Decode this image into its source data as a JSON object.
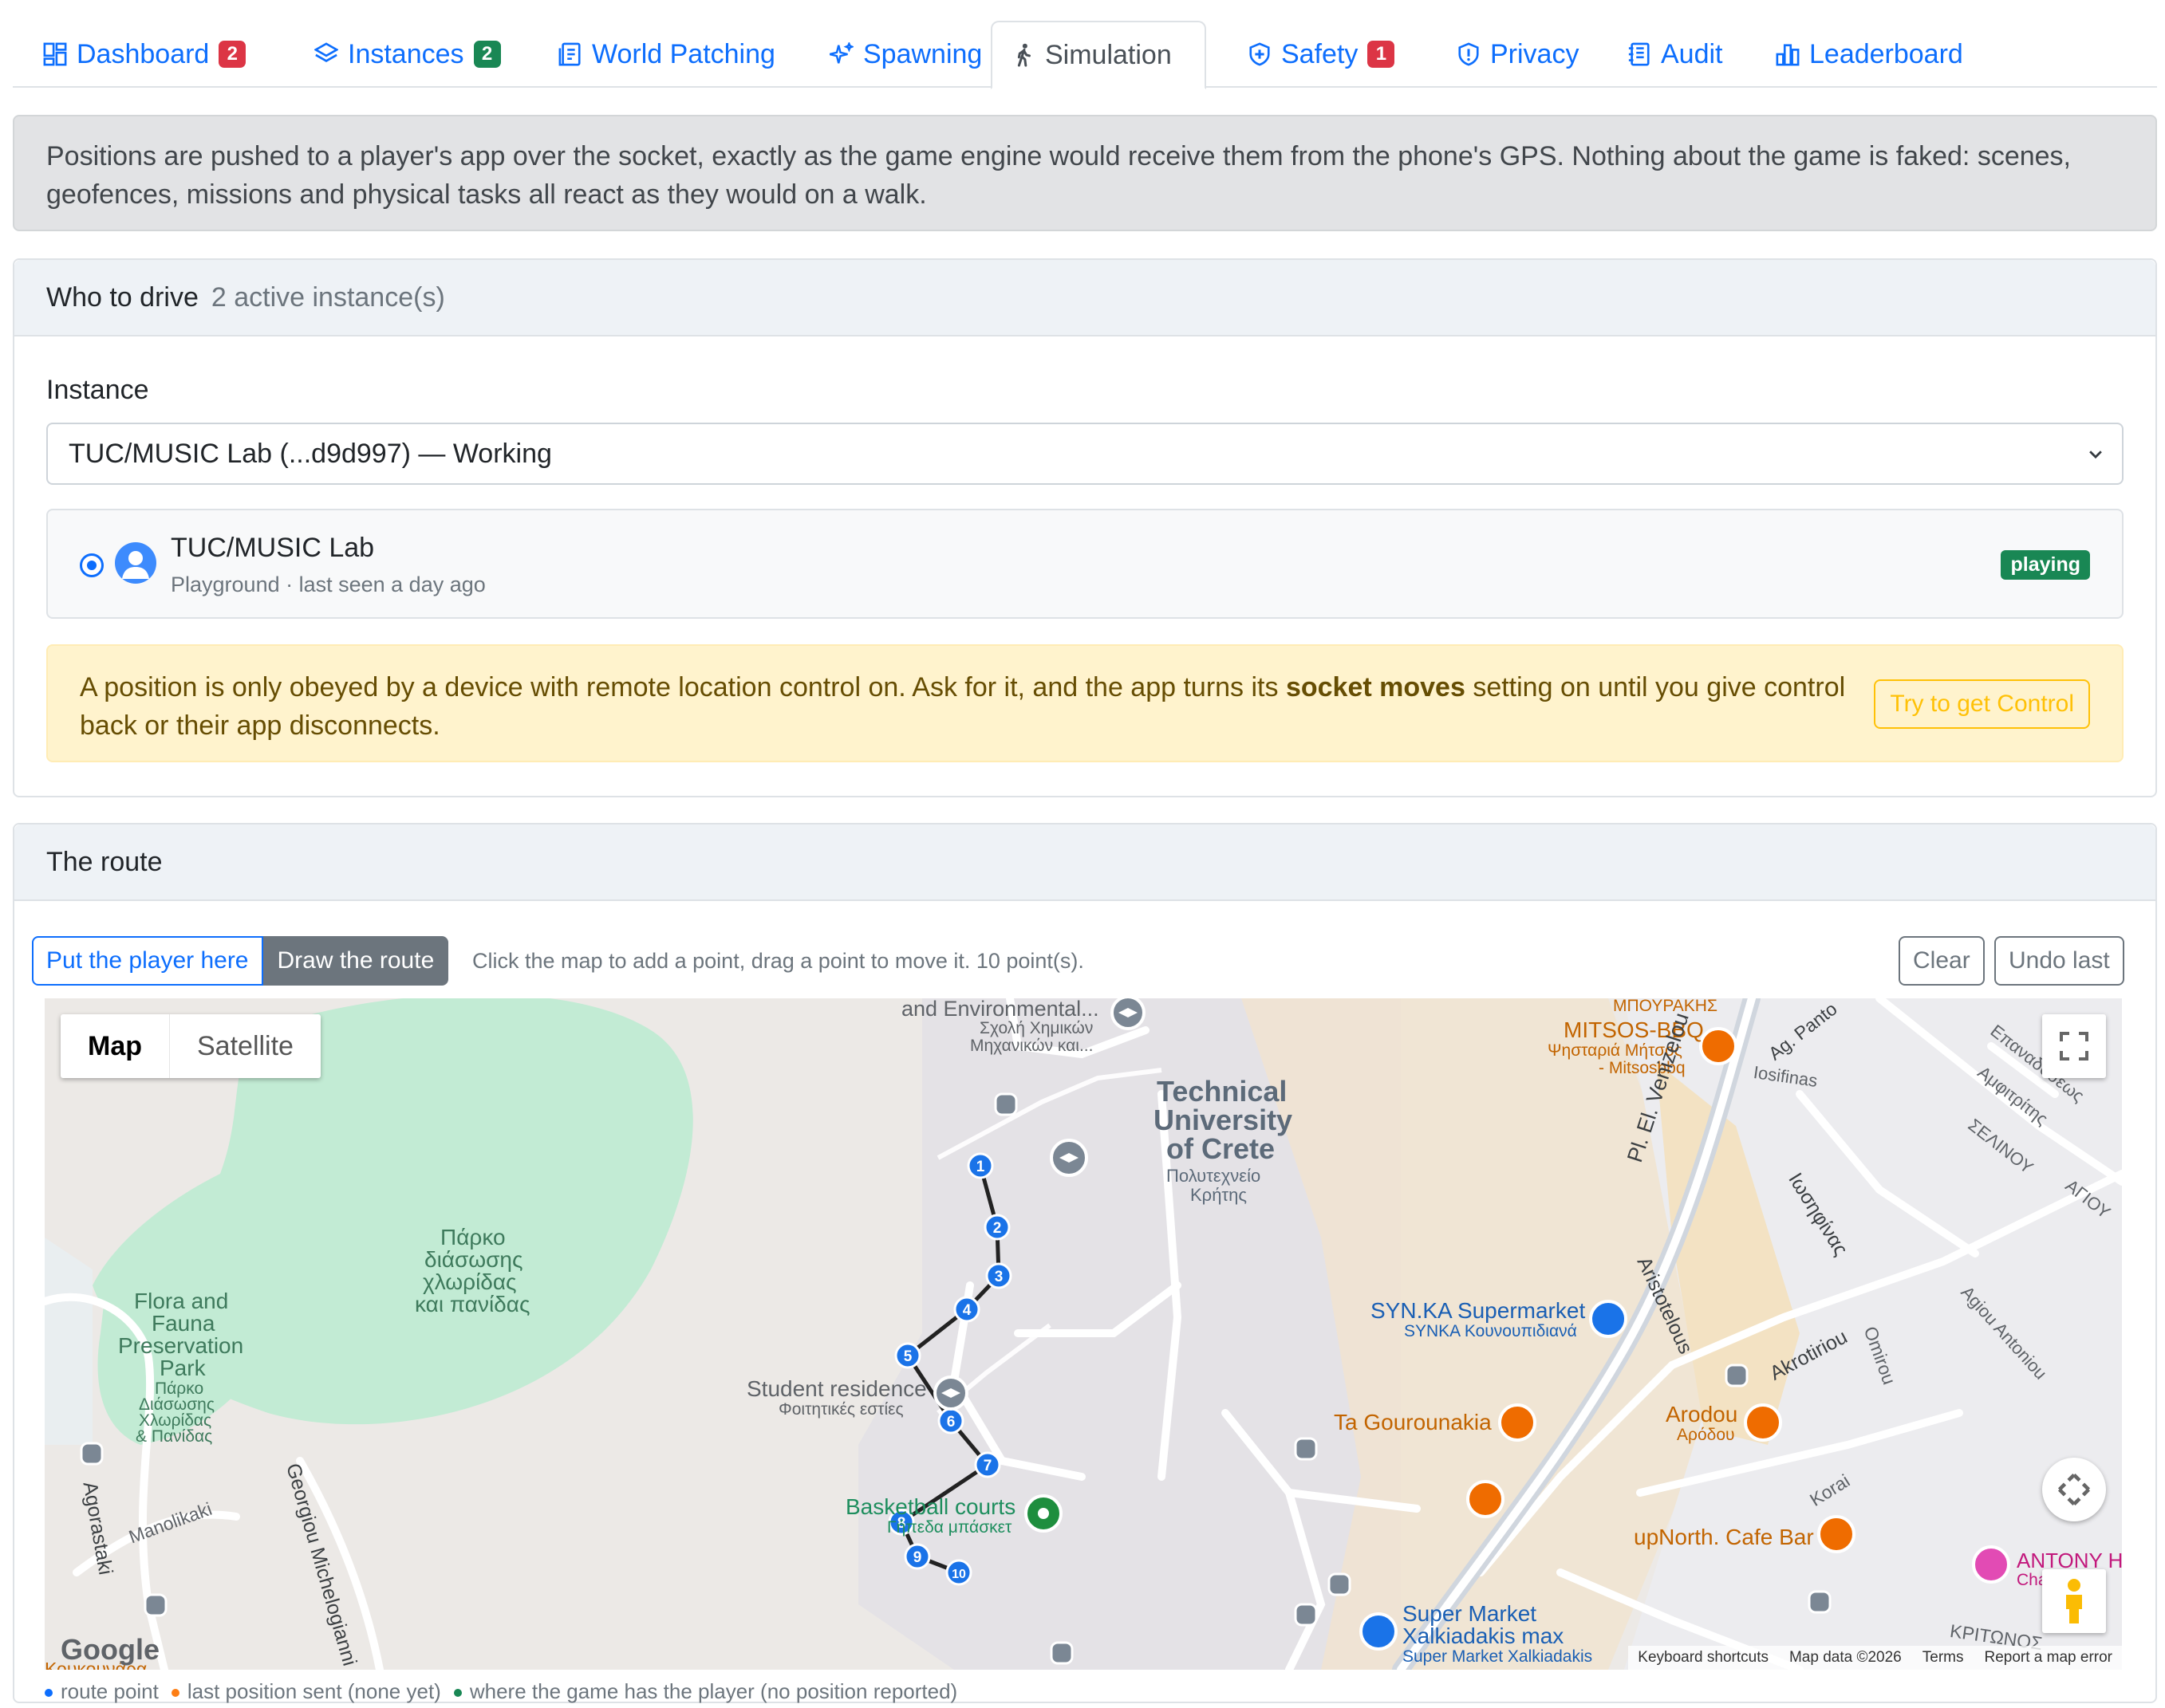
{
  "tabs": [
    {
      "label": "Dashboard",
      "badge": "2"
    },
    {
      "label": "Instances",
      "badge": "2"
    },
    {
      "label": "World Patching"
    },
    {
      "label": "Spawning"
    },
    {
      "label": "Simulation"
    },
    {
      "label": "Safety",
      "badge": "1"
    },
    {
      "label": "Privacy"
    },
    {
      "label": "Audit"
    },
    {
      "label": "Leaderboard"
    }
  ],
  "info": {
    "line1": "Positions are pushed to a player's app over the socket, exactly as the game engine would receive them from the phone's GPS. Nothing about the game is faked: scenes,",
    "line2": "geofences, missions and physical tasks all react as they would on a walk."
  },
  "drive": {
    "title": "Who to drive",
    "count": "2 active instance(s)",
    "instance_label": "Instance",
    "instance_value": "TUC/MUSIC Lab (...d9d997) — Working",
    "player_name": "TUC/MUSIC Lab",
    "player_sub": "Playground · last seen a day ago",
    "player_status": "playing",
    "warn_pre": "A position is only obeyed by a device with remote location control on. Ask for it, and the app turns its ",
    "warn_bold": "socket moves",
    "warn_post": " setting on until you give control back or their app disconnects.",
    "control_button": "Try to get Control"
  },
  "route": {
    "title": "The route",
    "put_player": "Put the player here",
    "draw_route": "Draw the route",
    "hint": "Click the map to add a point, drag a point to move it. 10 point(s).",
    "clear": "Clear",
    "undo": "Undo last",
    "points": [
      "1",
      "2",
      "3",
      "4",
      "5",
      "6",
      "7",
      "8",
      "9",
      "10"
    ]
  },
  "map": {
    "type_map": "Map",
    "type_satellite": "Satellite",
    "labels": {
      "env_school": "and Environmental...",
      "env_school_gr1": "Σχολή Χημικών",
      "env_school_gr2": "Μηχανικών και...",
      "tuc1": "Technical",
      "tuc2": "University",
      "tuc3": "of Crete",
      "tuc_gr1": "Πολυτεχνείο",
      "tuc_gr2": "Κρήτης",
      "park_gr1": "Πάρκο",
      "park_gr2": "διάσωσης",
      "park_gr3": "χλωρίδας",
      "park_gr4": "και πανίδας",
      "flora1": "Flora and",
      "flora2": "Fauna",
      "flora3": "Preservation",
      "flora4": "Park",
      "flora_gr1": "Πάρκο",
      "flora_gr2": "Διάσωσης",
      "flora_gr3": "Χλωρίδας",
      "flora_gr4": "& Πανίδας",
      "student": "Student residence",
      "student_gr": "Φοιτητικές εστίες",
      "basket": "Basketball courts",
      "basket_gr": "Γήπεδα μπάσκετ",
      "mitsos_gr_top": "ΜΠΟΥΡΑΚΗΣ",
      "mitsos": "MITSOS-BBQ",
      "mitsos_gr1": "Ψησταριά Μήτσος",
      "mitsos_gr2": "- Mitsosbbq",
      "synka": "SYN.KA Supermarket",
      "synka_gr": "SYNKA Κουνουπιδιανά",
      "gourounakia": "Ta Gourounakia",
      "arodou": "Arodou",
      "arodou_gr": "Αρόδου",
      "upnorth": "upNorth. Cafe Bar",
      "supermarket1": "Super Market",
      "supermarket2": "Xalkiadakis max",
      "supermarket_sub": "Super Market Xalkiadakis",
      "antony": "ANTONY H",
      "antony_sub": "Cha",
      "kritonos": "ΚΡΙΤΩΝΟΣ",
      "kouk": "Κουκουνάρα",
      "st_venizelou": "Pl. El. Venizelou",
      "st_aristotelous": "Aristotelous",
      "st_akrotiriou": "Akrotiriou",
      "st_omirou": "Omirou",
      "st_korai": "Korai",
      "st_iosifinas": "Iosifinas",
      "st_iosifinas_gr": "Ιωσηφίνας",
      "st_agpanto": "Ag. Panto",
      "st_epavaideos": "Επαναδόσεως",
      "st_amfitritis": "Αμφιτρίτης",
      "st_selinou": "ΣΕΛΙΝΟΥ",
      "st_agiou": "ΑΓΙΟΥ",
      "st_agantoniou": "Agiou Antoniou",
      "st_agorastaki": "Agorastaki",
      "st_manolikaki": "Manolikaki",
      "st_michelogianni": "Georgiou Michelogianni"
    },
    "google": "Google",
    "attr": {
      "keyboard": "Keyboard shortcuts",
      "mapdata": "Map data ©2026",
      "terms": "Terms",
      "report": "Report a map error"
    }
  },
  "legend": {
    "route_point": "route point",
    "last_sent": "last position sent (none yet)",
    "game_pos": "where the game has the player (no position reported)"
  },
  "colors": {
    "primary": "#0d6efd",
    "success": "#198754",
    "danger": "#dc3545",
    "warning": "#ffc107",
    "route_point": "#1a73e8",
    "park": "#c2ebd4",
    "food": "#ef6c00"
  }
}
